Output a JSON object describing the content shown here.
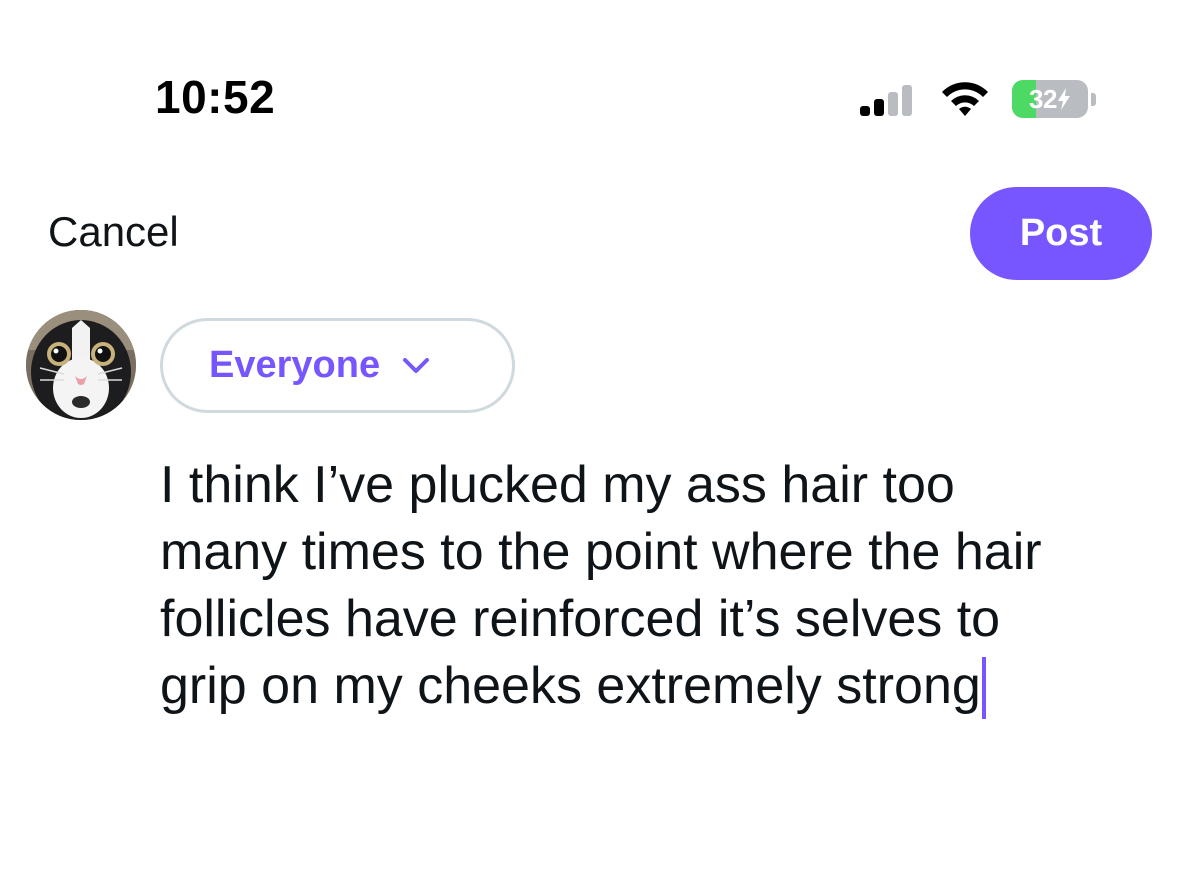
{
  "status_bar": {
    "time": "10:52",
    "battery_level": "32",
    "battery_fraction": 0.32,
    "signal_bars_active": 2,
    "signal_bars_total": 4
  },
  "header": {
    "cancel_label": "Cancel",
    "post_label": "Post"
  },
  "audience": {
    "label": "Everyone"
  },
  "compose": {
    "lines": [
      "I think I’ve plucked my ass hair too",
      "many times to the point where the hair",
      "follicles have reinforced it’s selves to",
      "grip on my cheeks extremely strong"
    ]
  },
  "colors": {
    "accent": "#7856ff",
    "text": "#0f1419",
    "pill_border": "#cfd9de",
    "battery_green": "#4cd964",
    "battery_gray": "#b9bcc1"
  },
  "icons": {
    "signal": "cellular-signal-icon",
    "wifi": "wifi-icon",
    "battery": "battery-charging-icon",
    "chevron": "chevron-down-icon"
  }
}
